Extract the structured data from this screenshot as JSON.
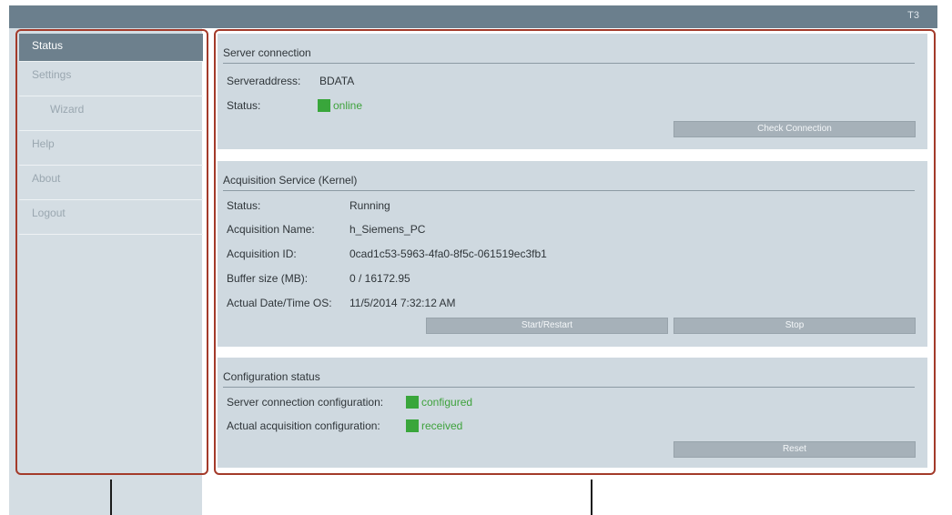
{
  "header": {
    "corner_label": "T3"
  },
  "sidebar": {
    "items": [
      {
        "label": "Status"
      },
      {
        "label": "Settings"
      },
      {
        "label": "Wizard"
      },
      {
        "label": "Help"
      },
      {
        "label": "About"
      },
      {
        "label": "Logout"
      }
    ],
    "active": "Status"
  },
  "server_connection": {
    "title": "Server connection",
    "address_label": "Serveraddress:",
    "address_value": "BDATA",
    "status_label": "Status:",
    "status_value": "online",
    "check_button": "Check Connection"
  },
  "acquisition": {
    "title": "Acquisition Service (Kernel)",
    "rows": [
      {
        "label": "Status:",
        "value": "Running"
      },
      {
        "label": "Acquisition Name:",
        "value": "h_Siemens_PC"
      },
      {
        "label": "Acquisition ID:",
        "value": "0cad1c53-5963-4fa0-8f5c-061519ec3fb1"
      },
      {
        "label": "Buffer size (MB):",
        "value": "0 / 16172.95"
      },
      {
        "label": "Actual Date/Time OS:",
        "value": "11/5/2014 7:32:12 AM"
      }
    ],
    "start_button": "Start/Restart",
    "stop_button": "Stop"
  },
  "configuration": {
    "title": "Configuration status",
    "server_config_label": "Server connection configuration:",
    "server_config_value": "configured",
    "acq_config_label": "Actual acquisition configuration:",
    "acq_config_value": "received",
    "reset_button": "Reset"
  },
  "colors": {
    "topbar": "#6b7f8d",
    "nav_active": "#6d808d",
    "panel": "#cfd9e0",
    "status_green": "#39a63b",
    "frame_red": "#a33a2a"
  }
}
